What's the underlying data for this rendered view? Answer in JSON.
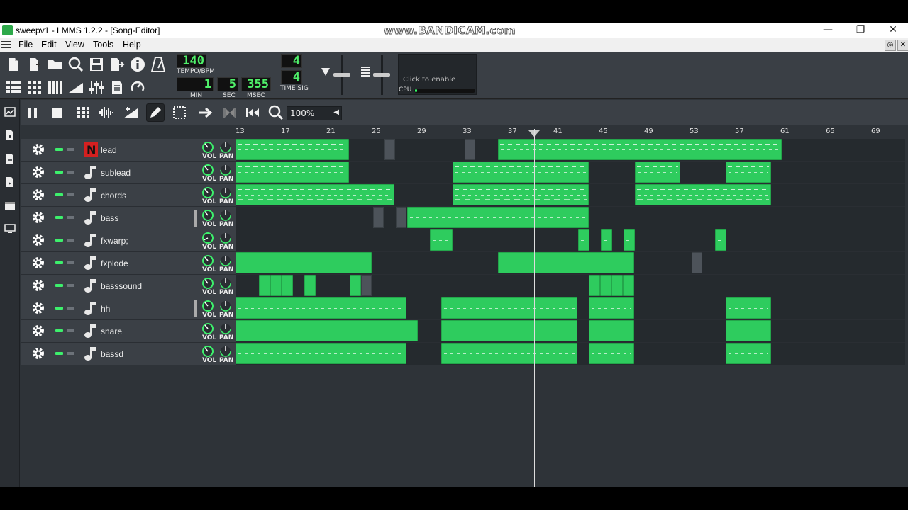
{
  "window": {
    "title": "sweepv1 - LMMS 1.2.2 - [Song-Editor]",
    "watermark": "www.BANDICAM.com",
    "minimize": "—",
    "restore": "❐",
    "close": "✕"
  },
  "menubar": {
    "items": [
      "File",
      "Edit",
      "View",
      "Tools",
      "Help"
    ]
  },
  "toolbar": {
    "tempo_value": "140",
    "tempo_label": "TEMPO/BPM",
    "time_min": "1",
    "time_sec": "5",
    "time_msec": "355",
    "min_label": "MIN",
    "sec_label": "SEC",
    "msec_label": "MSEC",
    "timesig_num": "4",
    "timesig_den": "4",
    "timesig_label": "TIME SIG",
    "cpu_hint": "Click to enable",
    "cpu_label": "CPU"
  },
  "song_editor": {
    "zoom": "100%",
    "bar_ticks": [
      "13",
      "17",
      "21",
      "25",
      "29",
      "33",
      "37",
      "41",
      "45",
      "49",
      "53",
      "57",
      "61",
      "65",
      "69"
    ]
  },
  "tracks": [
    {
      "name": "lead",
      "icon": "nescaline-icon"
    },
    {
      "name": "sublead",
      "icon": "note-icon"
    },
    {
      "name": "chords",
      "icon": "note-icon"
    },
    {
      "name": "bass",
      "icon": "note-icon"
    },
    {
      "name": "fxwarp;",
      "icon": "note-icon"
    },
    {
      "name": "fxplode",
      "icon": "note-icon"
    },
    {
      "name": "basssound",
      "icon": "note-icon"
    },
    {
      "name": "hh",
      "icon": "note-icon"
    },
    {
      "name": "snare",
      "icon": "note-icon"
    },
    {
      "name": "bassd",
      "icon": "note-icon"
    }
  ],
  "knob_labels": {
    "vol": "VOL",
    "pan": "PAN"
  },
  "colors": {
    "clip": "#2ecc5e",
    "lcd": "#4ff06a",
    "background": "#2e3338"
  }
}
